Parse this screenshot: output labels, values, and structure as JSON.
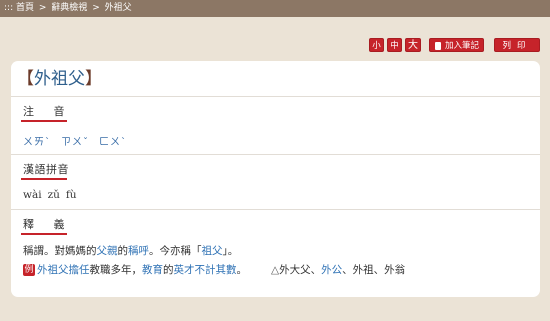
{
  "breadcrumb": {
    "prefix": ":::",
    "home": "首頁",
    "sep1": ">",
    "section": "辭典檢視",
    "sep2": ">",
    "current": "外祖父"
  },
  "font_size": {
    "small": "小",
    "medium": "中",
    "large": "大"
  },
  "actions": {
    "add_notes": "加入筆記",
    "print": "列印"
  },
  "entry": {
    "bracket_open": "【",
    "word": "外祖父",
    "bracket_close": "】"
  },
  "sections": {
    "zhuyin": {
      "label": "注 音",
      "values": [
        "ㄨㄞˋ",
        "ㄗㄨˇ",
        "ㄈㄨˋ"
      ]
    },
    "pinyin": {
      "label": "漢語拼音",
      "values": [
        "wài",
        "zǔ",
        "fù"
      ]
    },
    "definition": {
      "label": "釋 義",
      "line1": {
        "t1": "稱謂。對媽媽的",
        "l1": "父親",
        "t2": "的",
        "l2": "稱呼",
        "t3": "。今亦稱「",
        "l3": "祖父",
        "t4": "」。"
      },
      "example": {
        "badge": "例",
        "l1": "外祖父",
        "l2": "擔任",
        "t1": "教職多年，",
        "l3": "教育",
        "t2": "的",
        "l4": "英才",
        "l5": "不計其數",
        "t3": "。"
      },
      "related": {
        "triangle": "△",
        "t1": "外大父、",
        "l1": "外公",
        "t2": "、外祖、外翁"
      }
    }
  },
  "colors": {
    "accent": "#c6232a",
    "link": "#2f72b5",
    "topbar": "#8c7765",
    "background": "#ebe3d6"
  }
}
